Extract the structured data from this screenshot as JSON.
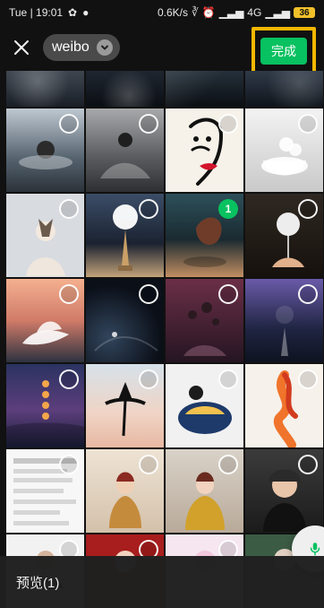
{
  "status_bar": {
    "time": "Tue | 19:01",
    "net_speed": "0.6K/s",
    "network": "4G",
    "battery": "36"
  },
  "top_bar": {
    "album_name": "weibo",
    "done_label": "完成"
  },
  "grid": {
    "rows": [
      [
        {
          "id": "r0c0",
          "selected": false
        },
        {
          "id": "r0c1",
          "selected": false
        },
        {
          "id": "r0c2",
          "selected": false
        },
        {
          "id": "r0c3",
          "selected": false
        }
      ],
      [
        {
          "id": "r1c0",
          "selected": false
        },
        {
          "id": "r1c1",
          "selected": false
        },
        {
          "id": "r1c2",
          "selected": false
        },
        {
          "id": "r1c3",
          "selected": false
        }
      ],
      [
        {
          "id": "r2c0",
          "selected": false
        },
        {
          "id": "r2c1",
          "selected": false
        },
        {
          "id": "r2c2",
          "selected": true,
          "badge": "1"
        },
        {
          "id": "r2c3",
          "selected": false
        }
      ],
      [
        {
          "id": "r3c0",
          "selected": false
        },
        {
          "id": "r3c1",
          "selected": false
        },
        {
          "id": "r3c2",
          "selected": false
        },
        {
          "id": "r3c3",
          "selected": false
        }
      ],
      [
        {
          "id": "r4c0",
          "selected": false
        },
        {
          "id": "r4c1",
          "selected": false
        },
        {
          "id": "r4c2",
          "selected": false
        },
        {
          "id": "r4c3",
          "selected": false
        }
      ],
      [
        {
          "id": "r5c0",
          "selected": false
        },
        {
          "id": "r5c1",
          "selected": false
        },
        {
          "id": "r5c2",
          "selected": false
        },
        {
          "id": "r5c3",
          "selected": false
        }
      ],
      [
        {
          "id": "r6c0",
          "selected": false
        },
        {
          "id": "r6c1",
          "selected": false
        },
        {
          "id": "r6c2",
          "selected": false
        },
        {
          "id": "r6c3",
          "selected": false
        }
      ]
    ]
  },
  "bottom_bar": {
    "preview_label": "预览(1)"
  },
  "colors": {
    "accent_green": "#08c160",
    "highlight_border": "#f2b700",
    "background": "#111111"
  },
  "icons": {
    "close": "close-icon",
    "chevron": "chevron-down-icon",
    "microphone": "microphone-icon"
  }
}
